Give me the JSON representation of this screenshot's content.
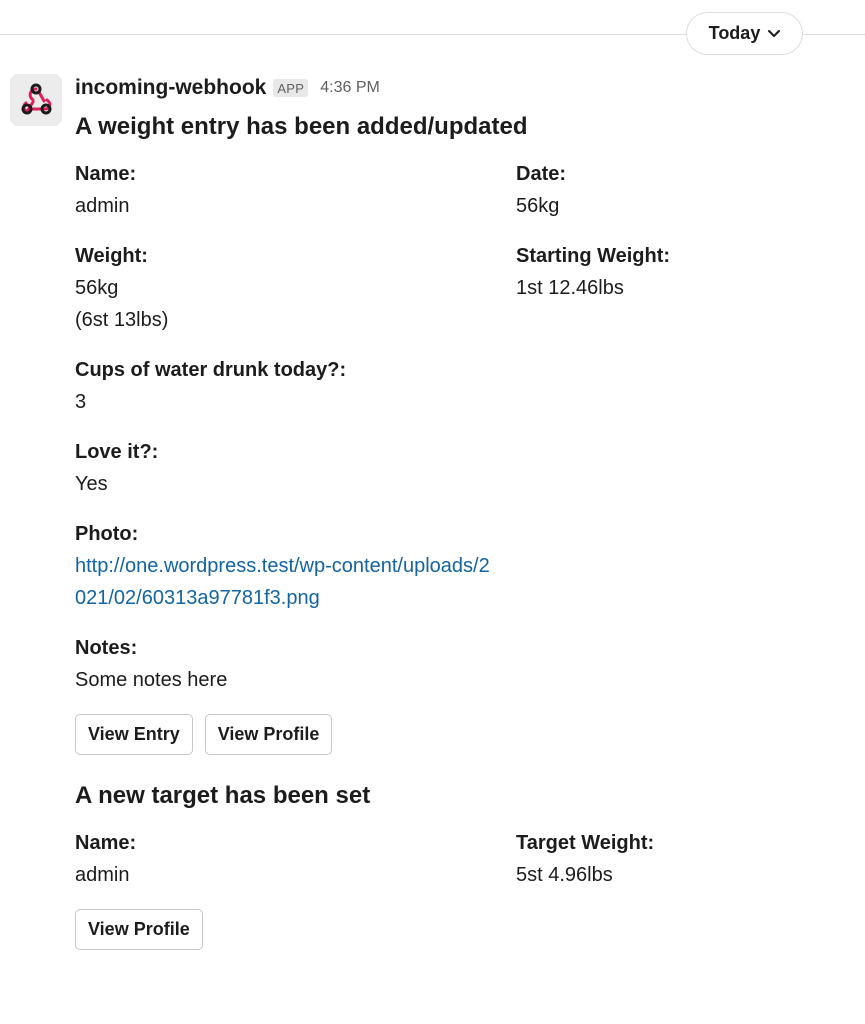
{
  "divider": {
    "label": "Today"
  },
  "message": {
    "sender": "incoming-webhook",
    "badge": "APP",
    "time": "4:36 PM",
    "block1": {
      "title": "A weight entry has been added/updated",
      "name_label": "Name:",
      "name_value": "admin",
      "date_label": "Date:",
      "date_value": "56kg",
      "weight_label": "Weight:",
      "weight_value": "56kg\n(6st 13lbs)",
      "starting_label": "Starting Weight:",
      "starting_value": "1st 12.46lbs",
      "water_label": "Cups of water drunk today?:",
      "water_value": "3",
      "love_label": "Love it?:",
      "love_value": "Yes",
      "photo_label": "Photo:",
      "photo_url": "http://one.wordpress.test/wp-content/uploads/2021/02/60313a97781f3.png",
      "notes_label": "Notes:",
      "notes_value": "Some notes here",
      "button_view_entry": "View Entry",
      "button_view_profile": "View Profile"
    },
    "block2": {
      "title": "A new target has been set",
      "name_label": "Name:",
      "name_value": "admin",
      "target_label": "Target Weight:",
      "target_value": "5st 4.96lbs",
      "button_view_profile": "View Profile"
    }
  },
  "colors": {
    "link": "#1264a3",
    "text": "#1d1c1d",
    "muted": "#616061",
    "webhook_icon": "#e01e5a"
  },
  "icons": {
    "avatar": "webhook-icon",
    "divider_chevron": "chevron-down-icon"
  }
}
